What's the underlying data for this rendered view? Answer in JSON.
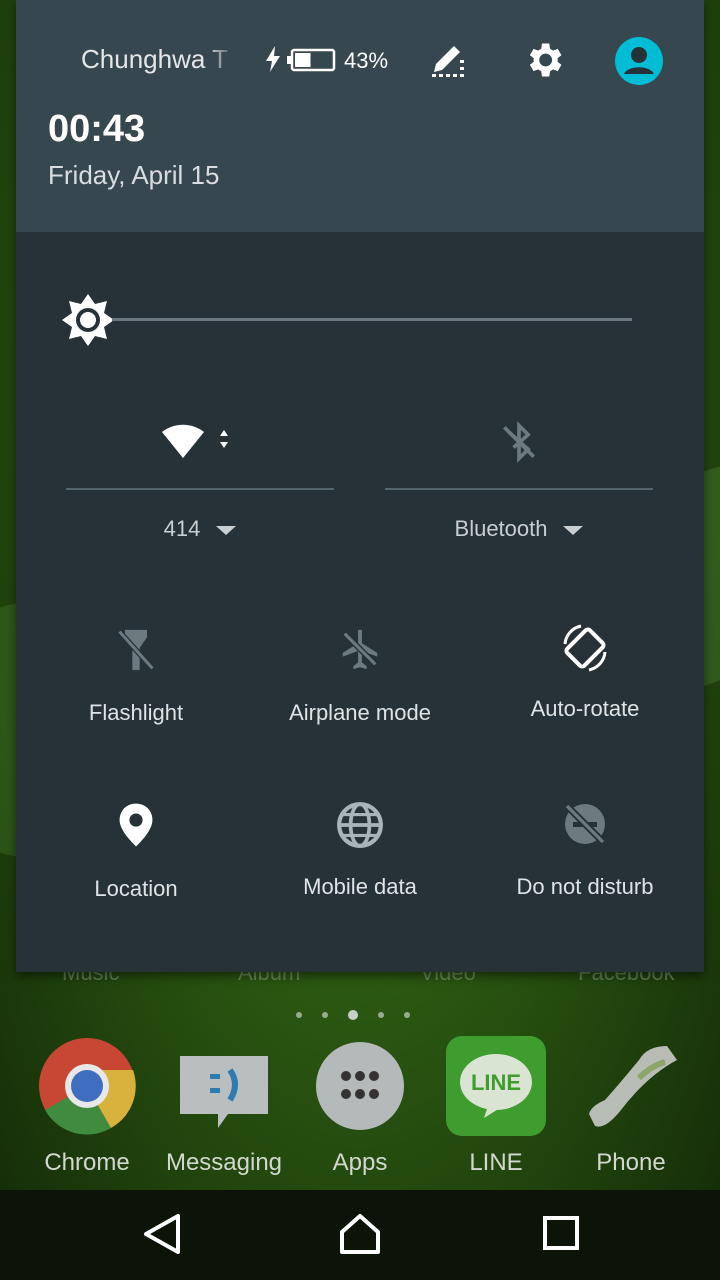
{
  "status": {
    "carrier": "Chunghwa T",
    "battery_percent": "43%",
    "battery_level": 0.43
  },
  "header": {
    "time": "00:43",
    "date": "Friday, April 15"
  },
  "brightness": {
    "level": 0.0
  },
  "wifi": {
    "label": "414"
  },
  "bluetooth": {
    "label": "Bluetooth"
  },
  "tiles": {
    "flashlight": "Flashlight",
    "airplane": "Airplane mode",
    "autorotate": "Auto-rotate",
    "location": "Location",
    "mobile_data": "Mobile data",
    "dnd": "Do not disturb"
  },
  "peek_labels": [
    "Music",
    "Album",
    "Video",
    "Facebook"
  ],
  "page_indicator": {
    "count": 5,
    "active_index": 2
  },
  "dock": [
    {
      "label": "Chrome",
      "icon": "chrome-icon"
    },
    {
      "label": "Messaging",
      "icon": "messaging-icon"
    },
    {
      "label": "Apps",
      "icon": "apps-icon"
    },
    {
      "label": "LINE",
      "icon": "line-icon",
      "icon_text": "LINE"
    },
    {
      "label": "Phone",
      "icon": "phone-icon"
    }
  ],
  "colors": {
    "shade_bg": "#263238",
    "header_bg": "#37474f",
    "accent": "#00bcd4"
  }
}
